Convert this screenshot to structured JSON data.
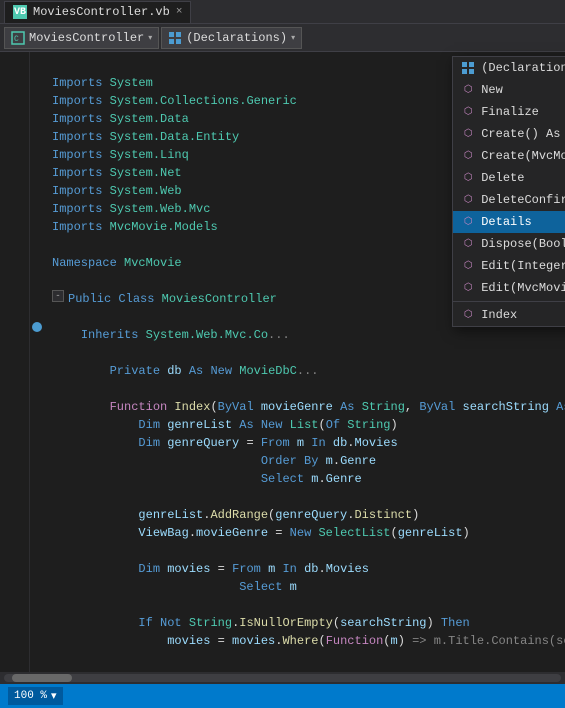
{
  "tab": {
    "filename": "MoviesController.vb",
    "icon": "VB",
    "close_label": "×"
  },
  "toolbar": {
    "left_dropdown": "MoviesController",
    "right_dropdown": "(Declarations)",
    "nav_prev": "◂",
    "nav_next": "▸"
  },
  "dropdown_menu": {
    "items": [
      {
        "icon": "grid",
        "label": "(Declarations)",
        "type": "declarations",
        "selected": true
      },
      {
        "icon": "method",
        "label": "New",
        "type": "method"
      },
      {
        "icon": "method",
        "label": "Finalize",
        "type": "method"
      },
      {
        "icon": "method",
        "label": "Create() As Web.Mvc.ActionResult",
        "type": "method"
      },
      {
        "icon": "method",
        "label": "Create(MvcMovie.Models.Movie) As Web.Mvc.",
        "type": "method"
      },
      {
        "icon": "method",
        "label": "Delete",
        "type": "method"
      },
      {
        "icon": "method",
        "label": "DeleteConfirmed",
        "type": "method"
      },
      {
        "icon": "method",
        "label": "Details",
        "type": "method",
        "highlighted": true
      },
      {
        "icon": "method",
        "label": "Dispose(Boolean)",
        "type": "method"
      },
      {
        "icon": "method",
        "label": "Edit(Integer?) As Web.Mvc.ActionResult",
        "type": "method"
      },
      {
        "icon": "method",
        "label": "Edit(MvcMovie.Models.Movie) As Web.Mvc.Ac",
        "type": "method"
      },
      {
        "icon": "method",
        "label": "Index",
        "type": "method"
      }
    ]
  },
  "code": {
    "lines": [
      {
        "num": "",
        "indent": 0,
        "text": "Imports System"
      },
      {
        "num": "",
        "indent": 0,
        "text": "Imports System.Collections.Generic"
      },
      {
        "num": "",
        "indent": 0,
        "text": "Imports System.Data"
      },
      {
        "num": "",
        "indent": 0,
        "text": "Imports System.Data.Entity"
      },
      {
        "num": "",
        "indent": 0,
        "text": "Imports System.Linq"
      },
      {
        "num": "",
        "indent": 0,
        "text": "Imports System.Net"
      },
      {
        "num": "",
        "indent": 0,
        "text": "Imports System.Web"
      },
      {
        "num": "",
        "indent": 0,
        "text": "Imports System.Web.Mvc"
      },
      {
        "num": "",
        "indent": 0,
        "text": "Imports MvcMovie.Models"
      },
      {
        "num": "",
        "indent": 0,
        "text": ""
      },
      {
        "num": "",
        "indent": 0,
        "text": "Namespace MvcMovie"
      },
      {
        "num": "",
        "indent": 1,
        "text": "Public Class MoviesController"
      },
      {
        "num": "",
        "indent": 2,
        "text": "Inherits System.Web.Mvc.Co..."
      },
      {
        "num": "",
        "indent": 0,
        "text": ""
      },
      {
        "num": "",
        "indent": 2,
        "text": "Private db As New MovieDbC..."
      },
      {
        "num": "",
        "indent": 0,
        "text": ""
      },
      {
        "num": "●",
        "indent": 2,
        "text": "Function Index(ByVal movieGenre As String, ByVal searchString As..."
      },
      {
        "num": "",
        "indent": 3,
        "text": "Dim genreList As New List(Of String)"
      },
      {
        "num": "",
        "indent": 3,
        "text": "Dim genreQuery = From m In db.Movies"
      },
      {
        "num": "",
        "indent": 4,
        "text": "Order By m.Genre"
      },
      {
        "num": "",
        "indent": 4,
        "text": "Select m.Genre"
      },
      {
        "num": "",
        "indent": 0,
        "text": ""
      },
      {
        "num": "",
        "indent": 3,
        "text": "genreList.AddRange(genreQuery.Distinct)"
      },
      {
        "num": "",
        "indent": 3,
        "text": "ViewBag.movieGenre = New SelectList(genreList)"
      },
      {
        "num": "",
        "indent": 0,
        "text": ""
      },
      {
        "num": "",
        "indent": 3,
        "text": "Dim movies = From m In db.Movies"
      },
      {
        "num": "",
        "indent": 4,
        "text": "Select m"
      },
      {
        "num": "",
        "indent": 0,
        "text": ""
      },
      {
        "num": "",
        "indent": 3,
        "text": "If Not String.IsNullOrEmpty(searchString) Then"
      },
      {
        "num": "",
        "indent": 4,
        "text": "movies = movies.Where(Function(m) => m.Title.Contains(searc..."
      }
    ]
  },
  "status_bar": {
    "zoom": "100 %",
    "zoom_arrow": "▾"
  }
}
